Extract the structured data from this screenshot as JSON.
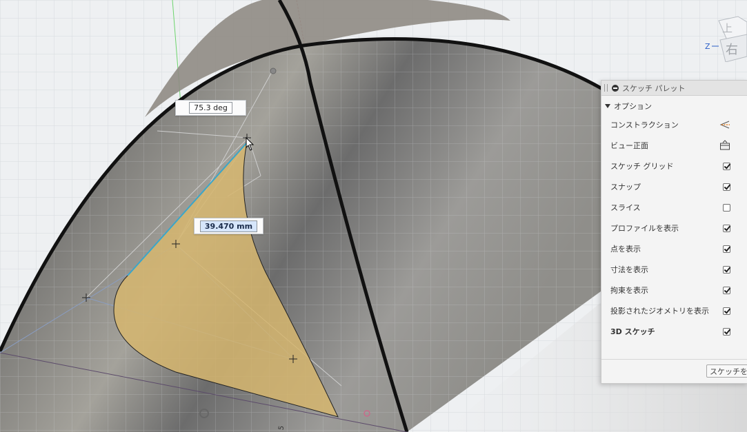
{
  "viewport": {
    "dimensions": {
      "angle": "75.3 deg",
      "length": "39.470 mm"
    },
    "axis_label": "Z",
    "partial_label": "5"
  },
  "viewcube": {
    "top_face": "上",
    "front_face": "右"
  },
  "palette": {
    "title": "スケッチ パレット",
    "section": "オプション",
    "rows": [
      {
        "label": "コンストラクション",
        "kind": "icon",
        "icon": "construction-line-icon"
      },
      {
        "label": "ビュー正面",
        "kind": "icon",
        "icon": "look-at-icon"
      },
      {
        "label": "スケッチ グリッド",
        "kind": "checkbox",
        "checked": true
      },
      {
        "label": "スナップ",
        "kind": "checkbox",
        "checked": true
      },
      {
        "label": "スライス",
        "kind": "checkbox",
        "checked": false
      },
      {
        "label": "プロファイルを表示",
        "kind": "checkbox",
        "checked": true
      },
      {
        "label": "点を表示",
        "kind": "checkbox",
        "checked": true
      },
      {
        "label": "寸法を表示",
        "kind": "checkbox",
        "checked": true
      },
      {
        "label": "拘束を表示",
        "kind": "checkbox",
        "checked": true
      },
      {
        "label": "投影されたジオメトリを表示",
        "kind": "checkbox",
        "checked": true
      },
      {
        "label": "3D スケッチ",
        "kind": "checkbox",
        "checked": true,
        "bold": true
      }
    ],
    "finish_button": "スケッチを"
  },
  "colors": {
    "profile_fill": "#d6b66e",
    "surface": "#8b8a86",
    "edge": "#111111",
    "construction": "#c7c7c7"
  }
}
